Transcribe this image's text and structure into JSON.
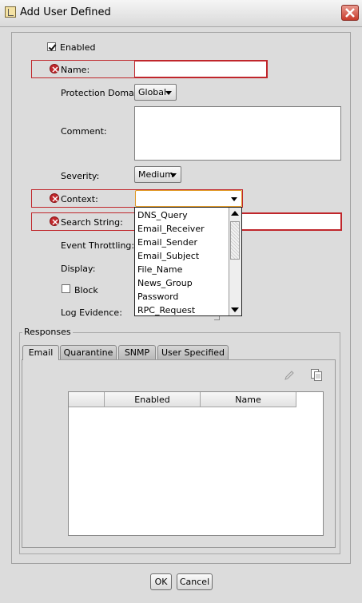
{
  "window": {
    "title": "Add User Defined"
  },
  "form": {
    "enabled": {
      "label": "Enabled",
      "checked": true
    },
    "name": {
      "label": "Name:",
      "value": ""
    },
    "protection_domain": {
      "label": "Protection Domain:",
      "value": "Global"
    },
    "comment": {
      "label": "Comment:",
      "value": ""
    },
    "severity": {
      "label": "Severity:",
      "value": "Medium"
    },
    "context": {
      "label": "Context:",
      "value": ""
    },
    "search_string": {
      "label": "Search String:",
      "value": ""
    },
    "event_throttling": {
      "label": "Event Throttling:"
    },
    "display": {
      "label": "Display:"
    },
    "block": {
      "label": "Block",
      "checked": false
    },
    "log_evidence": {
      "label": "Log Evidence:"
    }
  },
  "context_dropdown": {
    "options": [
      "DNS_Query",
      "Email_Receiver",
      "Email_Sender",
      "Email_Subject",
      "File_Name",
      "News_Group",
      "Password",
      "RPC_Request"
    ]
  },
  "responses": {
    "legend": "Responses",
    "tabs": [
      "Email",
      "Quarantine",
      "SNMP",
      "User Specified"
    ],
    "active_tab": "Email",
    "table": {
      "columns": [
        "",
        "Enabled",
        "Name"
      ],
      "rows": []
    },
    "toolbar_icons": [
      "edit-icon",
      "copy-icon"
    ]
  },
  "buttons": {
    "ok": "OK",
    "cancel": "Cancel"
  },
  "colors": {
    "error": "#c2282c",
    "focus": "#e09a2a",
    "background": "#dcdcdc"
  }
}
